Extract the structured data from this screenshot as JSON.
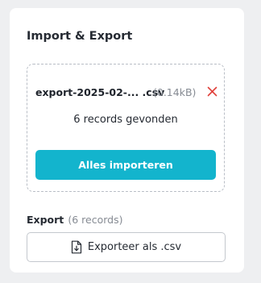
{
  "card": {
    "title": "Import & Export"
  },
  "import": {
    "file_name": "export-2025-02-... .csv",
    "file_size": "(0.14kB)",
    "remove_icon": "close-x-icon",
    "records_found": "6 records gevonden",
    "import_button_label": "Alles importeren"
  },
  "export": {
    "heading": "Export",
    "record_count": "(6 records)",
    "button_icon": "file-download-icon",
    "button_label": "Exporteer als .csv"
  },
  "colors": {
    "accent": "#13b4cd",
    "remove": "#e0403a",
    "muted_text": "#868b93",
    "page_background": "#eeeff1"
  }
}
